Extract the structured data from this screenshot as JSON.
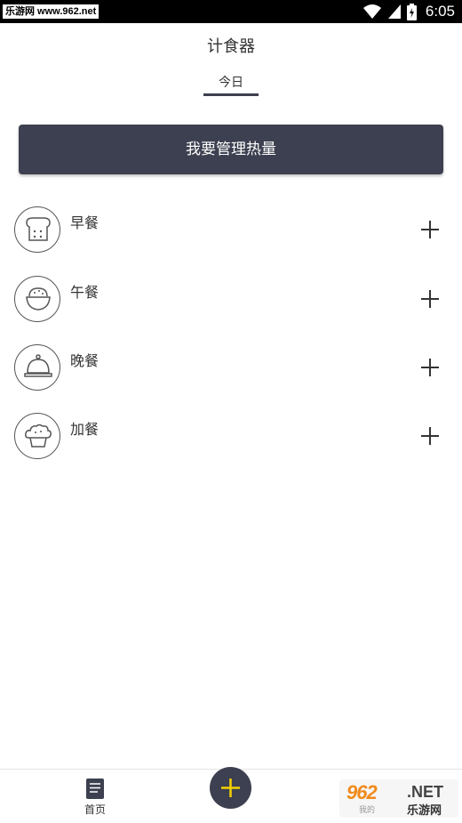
{
  "status_bar": {
    "watermark": "乐游网 www.962.net",
    "time": "6:05"
  },
  "header": {
    "title": "计食器"
  },
  "tabs": [
    {
      "label": "今日",
      "active": true
    }
  ],
  "manage_button": {
    "label": "我要管理热量"
  },
  "meals": [
    {
      "label": "早餐",
      "icon": "bread-icon"
    },
    {
      "label": "午餐",
      "icon": "rice-bowl-icon"
    },
    {
      "label": "晚餐",
      "icon": "cloche-icon"
    },
    {
      "label": "加餐",
      "icon": "muffin-icon"
    }
  ],
  "bottom_nav": {
    "home_label": "首页",
    "partial_label": "我的"
  },
  "watermark_badge": {
    "number": "962",
    "net": ".NET",
    "subtitle": "乐游网"
  },
  "colors": {
    "accent": "#3d4050",
    "fab_plus": "#f5d000"
  }
}
